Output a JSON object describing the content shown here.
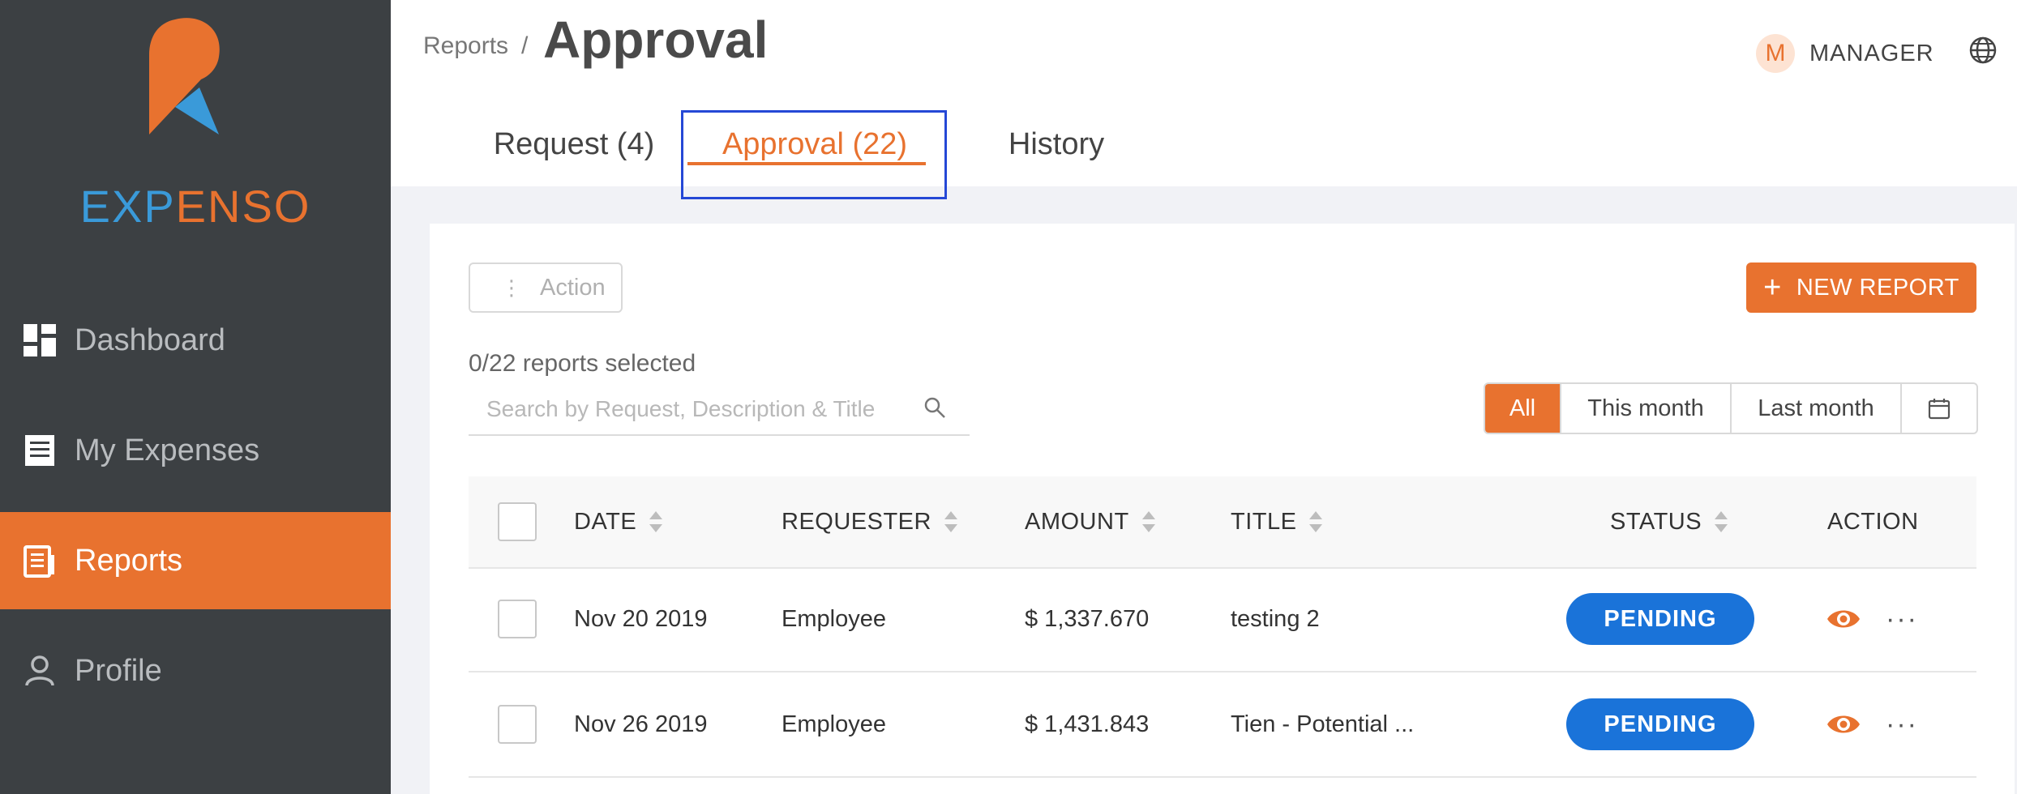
{
  "brand": {
    "logo_part1": "EXP",
    "logo_part2": "ENSO"
  },
  "sidebar": {
    "items": [
      {
        "label": "Dashboard",
        "icon": "dashboard-icon",
        "active": false
      },
      {
        "label": "My Expenses",
        "icon": "receipt-icon",
        "active": false
      },
      {
        "label": "Reports",
        "icon": "report-icon",
        "active": true
      },
      {
        "label": "Profile",
        "icon": "user-icon",
        "active": false
      }
    ]
  },
  "header": {
    "breadcrumb": "Reports",
    "breadcrumb_sep": "/",
    "title": "Approval",
    "user_initial": "M",
    "user_role": "MANAGER",
    "tabs": [
      {
        "label": "Request (4)",
        "active": false
      },
      {
        "label": "Approval (22)",
        "active": true
      },
      {
        "label": "History",
        "active": false
      }
    ]
  },
  "toolbar": {
    "action_label": "Action",
    "new_report_label": "NEW REPORT",
    "selected_text": "0/22 reports selected",
    "search_placeholder": "Search by Request, Description & Title",
    "filters": [
      {
        "label": "All",
        "active": true
      },
      {
        "label": "This month",
        "active": false
      },
      {
        "label": "Last month",
        "active": false
      }
    ]
  },
  "table": {
    "columns": {
      "date": "DATE",
      "requester": "REQUESTER",
      "amount": "AMOUNT",
      "title": "TITLE",
      "status": "STATUS",
      "action": "ACTION"
    },
    "rows": [
      {
        "date": "Nov 20 2019",
        "requester": "Employee",
        "amount": "$ 1,337.670",
        "title": "testing 2",
        "status": "PENDING"
      },
      {
        "date": "Nov 26 2019",
        "requester": "Employee",
        "amount": "$ 1,431.843",
        "title": "Tien - Potential ...",
        "status": "PENDING"
      }
    ]
  },
  "colors": {
    "accent": "#e8722f",
    "sidebar": "#3c4043",
    "status_pending": "#1a73d9",
    "logo_blue": "#3a9ad9"
  }
}
